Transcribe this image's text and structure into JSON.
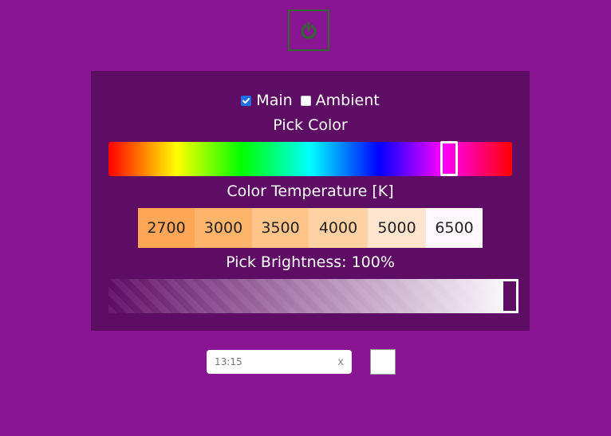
{
  "power_button": {
    "icon": "power-icon",
    "icon_color": "#2a6a2a"
  },
  "modes": [
    {
      "label": "Main",
      "checked": true
    },
    {
      "label": "Ambient",
      "checked": false
    }
  ],
  "pick_color": {
    "title": "Pick Color",
    "selected_hue_degrees": 304
  },
  "color_temperature": {
    "title": "Color Temperature [K]",
    "options": [
      {
        "label": "2700",
        "color": "#ffa757"
      },
      {
        "label": "3000",
        "color": "#ffb46b"
      },
      {
        "label": "3500",
        "color": "#ffc489"
      },
      {
        "label": "4000",
        "color": "#ffd1a3"
      },
      {
        "label": "5000",
        "color": "#ffe4ce"
      },
      {
        "label": "6500",
        "color": "#fff9fd"
      }
    ]
  },
  "brightness": {
    "title": "Pick Brightness: 100%",
    "level_percent": 100
  },
  "timer": {
    "value": "13:15",
    "clear_label": "x"
  },
  "selected_color": {
    "color": "#ffffff"
  },
  "colors": {
    "background": "#8a1593",
    "panel": "#5d0d63"
  }
}
